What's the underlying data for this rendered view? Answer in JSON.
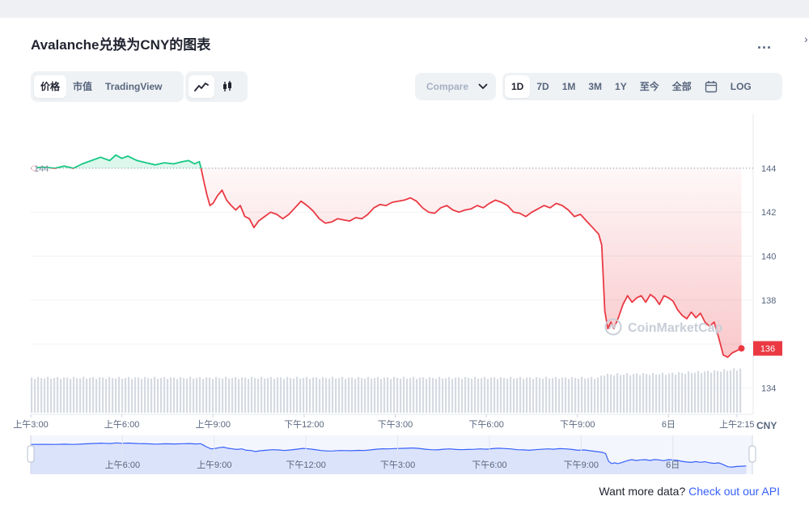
{
  "title": "Avalanche兑换为CNY的图表",
  "more_label": "...",
  "view_tabs": [
    {
      "label": "价格",
      "active": true
    },
    {
      "label": "市值",
      "active": false
    },
    {
      "label": "TradingView",
      "active": false
    }
  ],
  "chart_style_icons": [
    "line-chart-icon",
    "candlestick-icon"
  ],
  "compare": {
    "label": "Compare"
  },
  "range_tabs": [
    {
      "label": "1D",
      "active": true
    },
    {
      "label": "7D",
      "active": false
    },
    {
      "label": "1M",
      "active": false
    },
    {
      "label": "3M",
      "active": false
    },
    {
      "label": "1Y",
      "active": false
    },
    {
      "label": "至今",
      "active": false
    },
    {
      "label": "全部",
      "active": false
    }
  ],
  "calendar_icon": "calendar-icon",
  "log_label": "LOG",
  "watermark": "CoinMarketCap",
  "footer": {
    "text": "Want more data?",
    "link": "Check out our API"
  },
  "colors": {
    "up": "#16c784",
    "down": "#ea3943",
    "navigator": "#3861fb",
    "link": "#3861fb"
  },
  "chart_data": {
    "type": "line",
    "currency": "CNY",
    "open_price": 144,
    "open_price_label": "144",
    "current_price": 136,
    "current_price_label": "136",
    "y_ticks": [
      144,
      142,
      140,
      138,
      136,
      134
    ],
    "y_tick_labels": [
      "144",
      "142",
      "140",
      "138",
      "136",
      "134"
    ],
    "ylim": [
      132.8,
      146.5
    ],
    "x_ticks": [
      {
        "t": 0,
        "label": "上午3:00"
      },
      {
        "t": 3,
        "label": "上午6:00"
      },
      {
        "t": 6,
        "label": "上午9:00"
      },
      {
        "t": 9,
        "label": "下午12:00"
      },
      {
        "t": 12,
        "label": "下午3:00"
      },
      {
        "t": 15,
        "label": "下午6:00"
      },
      {
        "t": 18,
        "label": "下午9:00"
      },
      {
        "t": 21,
        "label": "6日"
      },
      {
        "t": 23.25,
        "label": "上午2:15"
      }
    ],
    "xlim": [
      0,
      23.6
    ],
    "navigator_ticks": [
      {
        "t": 3,
        "label": "上午6:00"
      },
      {
        "t": 6,
        "label": "上午9:00"
      },
      {
        "t": 9,
        "label": "下午12:00"
      },
      {
        "t": 12,
        "label": "下午3:00"
      },
      {
        "t": 15,
        "label": "下午6:00"
      },
      {
        "t": 18,
        "label": "下午9:00"
      },
      {
        "t": 21,
        "label": "6日"
      }
    ],
    "series": [
      {
        "points": [
          [
            0.0,
            144.0
          ],
          [
            0.4,
            144.05
          ],
          [
            0.8,
            144.0
          ],
          [
            1.1,
            144.1
          ],
          [
            1.4,
            144.0
          ],
          [
            1.7,
            144.2
          ],
          [
            2.0,
            144.35
          ],
          [
            2.3,
            144.5
          ],
          [
            2.6,
            144.35
          ],
          [
            2.8,
            144.6
          ],
          [
            3.0,
            144.45
          ],
          [
            3.2,
            144.55
          ],
          [
            3.5,
            144.35
          ],
          [
            3.8,
            144.25
          ],
          [
            4.1,
            144.15
          ],
          [
            4.4,
            144.25
          ],
          [
            4.7,
            144.2
          ],
          [
            5.0,
            144.3
          ],
          [
            5.2,
            144.35
          ],
          [
            5.4,
            144.2
          ],
          [
            5.55,
            144.3
          ],
          [
            5.6,
            144.05
          ],
          [
            5.7,
            143.4
          ],
          [
            5.8,
            142.8
          ],
          [
            5.9,
            142.3
          ],
          [
            6.0,
            142.4
          ],
          [
            6.15,
            142.75
          ],
          [
            6.3,
            143.0
          ],
          [
            6.45,
            142.55
          ],
          [
            6.6,
            142.3
          ],
          [
            6.75,
            142.1
          ],
          [
            6.9,
            142.3
          ],
          [
            7.05,
            141.8
          ],
          [
            7.2,
            141.7
          ],
          [
            7.35,
            141.3
          ],
          [
            7.5,
            141.6
          ],
          [
            7.7,
            141.8
          ],
          [
            7.9,
            142.0
          ],
          [
            8.1,
            141.9
          ],
          [
            8.3,
            141.7
          ],
          [
            8.5,
            141.9
          ],
          [
            8.7,
            142.2
          ],
          [
            8.9,
            142.5
          ],
          [
            9.1,
            142.3
          ],
          [
            9.3,
            142.05
          ],
          [
            9.5,
            141.7
          ],
          [
            9.7,
            141.5
          ],
          [
            9.9,
            141.55
          ],
          [
            10.1,
            141.7
          ],
          [
            10.3,
            141.65
          ],
          [
            10.5,
            141.6
          ],
          [
            10.7,
            141.75
          ],
          [
            10.9,
            141.7
          ],
          [
            11.1,
            141.9
          ],
          [
            11.3,
            142.2
          ],
          [
            11.5,
            142.35
          ],
          [
            11.7,
            142.3
          ],
          [
            11.9,
            142.45
          ],
          [
            12.1,
            142.5
          ],
          [
            12.3,
            142.55
          ],
          [
            12.5,
            142.65
          ],
          [
            12.7,
            142.5
          ],
          [
            12.9,
            142.2
          ],
          [
            13.1,
            142.0
          ],
          [
            13.3,
            141.95
          ],
          [
            13.5,
            142.2
          ],
          [
            13.7,
            142.3
          ],
          [
            13.9,
            142.1
          ],
          [
            14.1,
            142.0
          ],
          [
            14.3,
            142.1
          ],
          [
            14.5,
            142.15
          ],
          [
            14.7,
            142.3
          ],
          [
            14.9,
            142.2
          ],
          [
            15.1,
            142.4
          ],
          [
            15.3,
            142.55
          ],
          [
            15.5,
            142.45
          ],
          [
            15.7,
            142.3
          ],
          [
            15.9,
            142.0
          ],
          [
            16.1,
            141.95
          ],
          [
            16.3,
            141.8
          ],
          [
            16.5,
            142.0
          ],
          [
            16.7,
            142.15
          ],
          [
            16.9,
            142.3
          ],
          [
            17.1,
            142.2
          ],
          [
            17.3,
            142.4
          ],
          [
            17.5,
            142.3
          ],
          [
            17.7,
            142.1
          ],
          [
            17.9,
            141.8
          ],
          [
            18.1,
            141.9
          ],
          [
            18.3,
            141.6
          ],
          [
            18.5,
            141.3
          ],
          [
            18.7,
            141.0
          ],
          [
            18.8,
            140.5
          ],
          [
            18.9,
            137.5
          ],
          [
            19.0,
            136.7
          ],
          [
            19.1,
            137.0
          ],
          [
            19.2,
            136.7
          ],
          [
            19.35,
            137.2
          ],
          [
            19.5,
            137.8
          ],
          [
            19.65,
            138.2
          ],
          [
            19.8,
            137.9
          ],
          [
            19.95,
            138.1
          ],
          [
            20.1,
            138.2
          ],
          [
            20.25,
            137.9
          ],
          [
            20.4,
            138.25
          ],
          [
            20.55,
            138.1
          ],
          [
            20.7,
            137.8
          ],
          [
            20.85,
            138.2
          ],
          [
            21.0,
            138.1
          ],
          [
            21.15,
            137.95
          ],
          [
            21.3,
            137.55
          ],
          [
            21.45,
            137.3
          ],
          [
            21.6,
            137.15
          ],
          [
            21.75,
            137.45
          ],
          [
            21.9,
            137.2
          ],
          [
            22.05,
            137.4
          ],
          [
            22.2,
            137.0
          ],
          [
            22.35,
            136.8
          ],
          [
            22.5,
            137.0
          ],
          [
            22.65,
            136.3
          ],
          [
            22.8,
            135.5
          ],
          [
            22.95,
            135.4
          ],
          [
            23.1,
            135.6
          ],
          [
            23.25,
            135.7
          ],
          [
            23.4,
            135.8
          ]
        ]
      }
    ],
    "volume": {
      "ylim": [
        0,
        1
      ],
      "points": [
        [
          0,
          0.42
        ],
        [
          5.5,
          0.42
        ],
        [
          5.6,
          0.42
        ],
        [
          12,
          0.42
        ],
        [
          18,
          0.42
        ],
        [
          18.7,
          0.42
        ],
        [
          18.8,
          0.46
        ],
        [
          21,
          0.47
        ],
        [
          22.5,
          0.5
        ],
        [
          23.4,
          0.53
        ]
      ]
    },
    "grid": true,
    "legend": "none"
  }
}
